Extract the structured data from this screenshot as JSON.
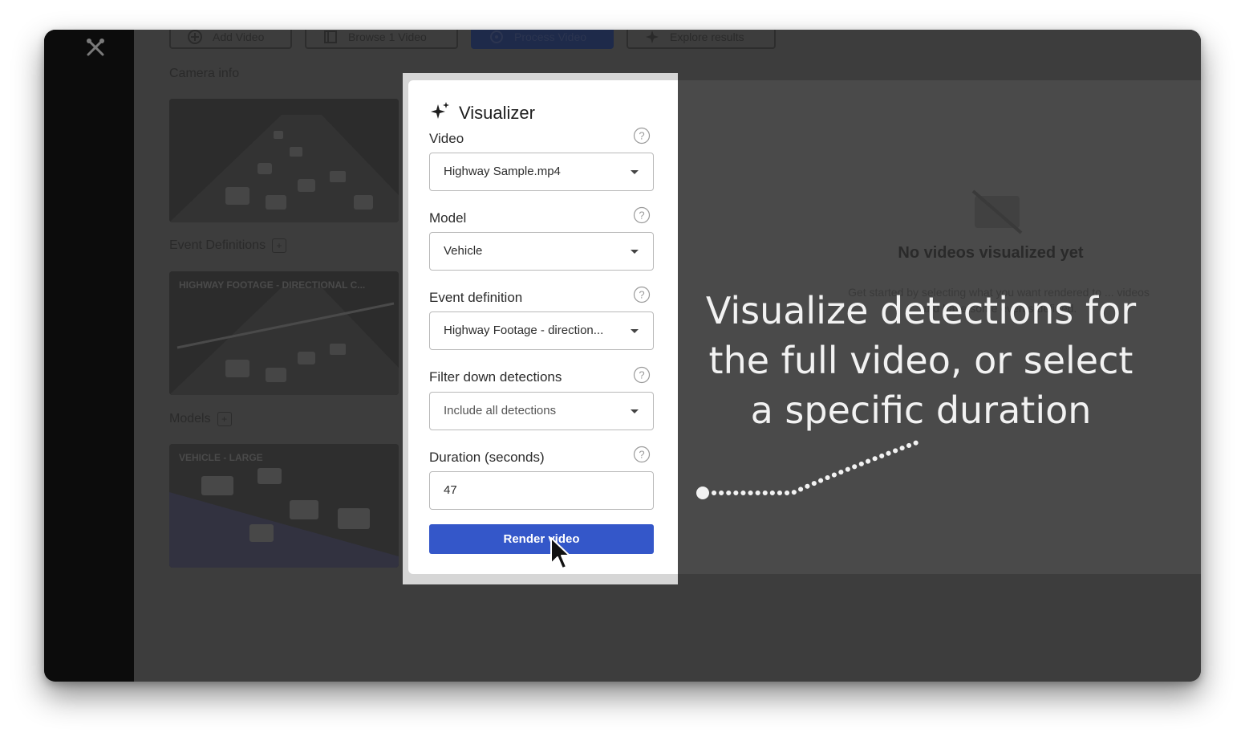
{
  "toolbar": {
    "add_video": "Add Video",
    "browse_video": "Browse 1 Video",
    "process_video": "Process Video",
    "explore_results": "Explore results"
  },
  "left_panel": {
    "camera_info": "Camera info",
    "event_definitions": "Event Definitions",
    "event_thumb_label": "HIGHWAY FOOTAGE - DIRECTIONAL C...",
    "models": "Models",
    "model_thumb_label": "VEHICLE - LARGE",
    "add_symbol": "+"
  },
  "empty_state": {
    "title": "No videos visualized yet",
    "subtitle": "Get started by selecting what you want rendered to ... videos and have some events defined."
  },
  "visualizer": {
    "title": "Visualizer",
    "video_label": "Video",
    "video_value": "Highway Sample.mp4",
    "model_label": "Model",
    "model_value": "Vehicle",
    "event_label": "Event definition",
    "event_value": "Highway Footage - direction...",
    "filter_label": "Filter down detections",
    "filter_value": "Include all detections",
    "duration_label": "Duration (seconds)",
    "duration_value": "47",
    "render_button": "Render video"
  },
  "caption": "Visualize detections for the full video, or select a specific duration",
  "colors": {
    "primary_button": "#3457c9",
    "overlay": "#3d3d3d",
    "sidebar": "#0c0c0c"
  },
  "icons": [
    "tools-icon",
    "add-video-icon",
    "browse-icon",
    "process-icon",
    "explore-icon",
    "sparkle-icon",
    "help-icon",
    "no-video-icon",
    "cursor-icon"
  ]
}
